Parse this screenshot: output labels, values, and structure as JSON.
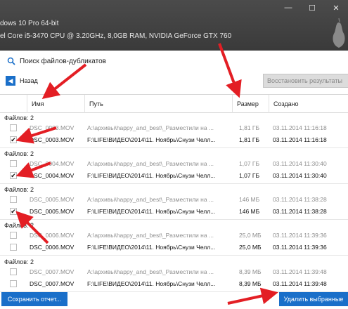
{
  "titlebar": {
    "os_line": "dows 10 Pro 64-bit",
    "hw_line": "el Core i5-3470 CPU @ 3.20GHz, 8,0GB RAM, NVIDIA GeForce GTX 760",
    "minimize": "—",
    "maximize": "☐",
    "close": "✕"
  },
  "app": {
    "title": "Поиск файлов-дубликатов",
    "back_label": "Назад",
    "restore_label": "Восстановить результаты"
  },
  "columns": {
    "name": "Имя",
    "path": "Путь",
    "size": "Размер",
    "created": "Создано"
  },
  "groups": [
    {
      "label": "Файлов: 2",
      "rows": [
        {
          "checked": "",
          "name": "DSC_0003.MOV",
          "path": "A:\\архивы\\happy_and_best\\_Разместили на ...",
          "size": "1,81 ГБ",
          "date": "03.11.2014 11:16:18"
        },
        {
          "checked": "✔",
          "name": "DSC_0003.MOV",
          "path": "F:\\LIFE\\ВИДЕО\\2014\\11. Ноябрь\\Снузи Челл...",
          "size": "1,81 ГБ",
          "date": "03.11.2014 11:16:18"
        }
      ]
    },
    {
      "label": "Файлов: 2",
      "rows": [
        {
          "checked": "",
          "name": "DSC_0004.MOV",
          "path": "A:\\архивы\\happy_and_best\\_Разместили на ...",
          "size": "1,07 ГБ",
          "date": "03.11.2014 11:30:40"
        },
        {
          "checked": "✔",
          "name": "DSC_0004.MOV",
          "path": "F:\\LIFE\\ВИДЕО\\2014\\11. Ноябрь\\Снузи Челл...",
          "size": "1,07 ГБ",
          "date": "03.11.2014 11:30:40"
        }
      ]
    },
    {
      "label": "Файлов: 2",
      "rows": [
        {
          "checked": "",
          "name": "DSC_0005.MOV",
          "path": "A:\\архивы\\happy_and_best\\_Разместили на ...",
          "size": "146 МБ",
          "date": "03.11.2014 11:38:28"
        },
        {
          "checked": "✔",
          "name": "DSC_0005.MOV",
          "path": "F:\\LIFE\\ВИДЕО\\2014\\11. Ноябрь\\Снузи Челл...",
          "size": "146 МБ",
          "date": "03.11.2014 11:38:28"
        }
      ]
    },
    {
      "label": "Файлов: 2",
      "rows": [
        {
          "checked": "",
          "name": "DSC_0006.MOV",
          "path": "A:\\архивы\\happy_and_best\\_Разместили на ...",
          "size": "25,0 МБ",
          "date": "03.11.2014 11:39:36"
        },
        {
          "checked": "",
          "name": "DSC_0006.MOV",
          "path": "F:\\LIFE\\ВИДЕО\\2014\\11. Ноябрь\\Снузи Челл...",
          "size": "25,0 МБ",
          "date": "03.11.2014 11:39:36"
        }
      ]
    },
    {
      "label": "Файлов: 2",
      "rows": [
        {
          "checked": "",
          "name": "DSC_0007.MOV",
          "path": "A:\\архивы\\happy_and_best\\_Разместили на ...",
          "size": "8,39 МБ",
          "date": "03.11.2014 11:39:48"
        },
        {
          "checked": "",
          "name": "DSC_0007.MOV",
          "path": "F:\\LIFE\\ВИДЕО\\2014\\11. Ноябрь\\Снузи Челл...",
          "size": "8,39 МБ",
          "date": "03.11.2014 11:39:48"
        }
      ]
    }
  ],
  "footer": {
    "save_label": "Сохранить отчет...",
    "delete_label": "Удалить выбранные"
  },
  "colors": {
    "accent": "#1a6fc9",
    "annotation": "#e31e24"
  },
  "icons": {
    "app": "magnifier-icon",
    "back": "back-arrow-icon",
    "brand": "pear-logo-icon"
  }
}
